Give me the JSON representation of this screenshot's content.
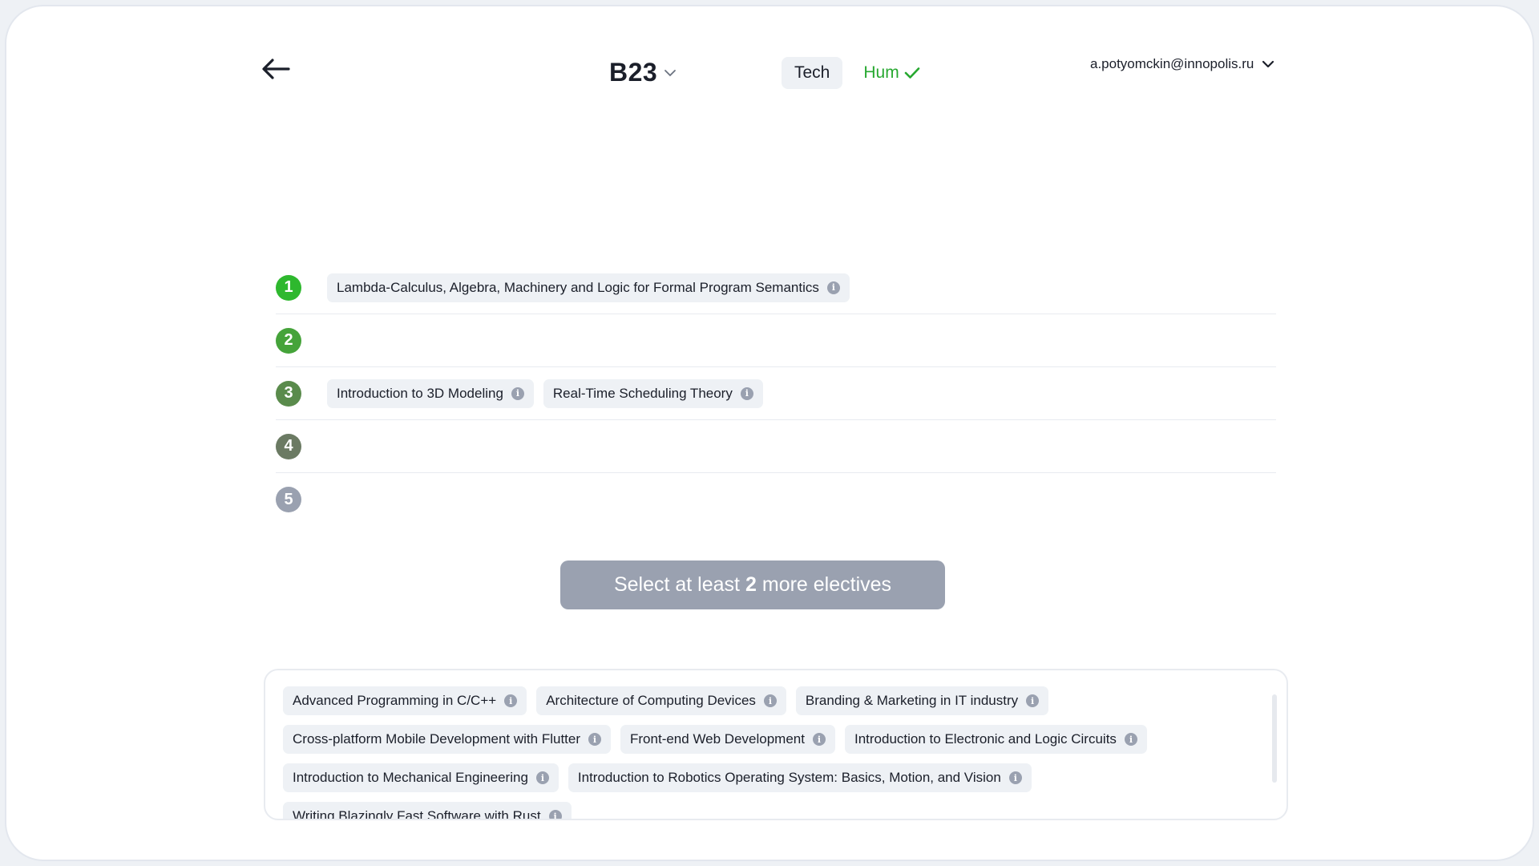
{
  "header": {
    "group": "B23",
    "tabs": [
      {
        "label": "Tech",
        "selected": true
      },
      {
        "label": "Hum",
        "completed": true
      }
    ],
    "user_email": "a.potyomckin@innopolis.ru"
  },
  "priorities": [
    {
      "number": "1",
      "color": "#2eb82e",
      "courses": [
        "Lambda-Calculus, Algebra, Machinery and Logic for Formal Program Semantics"
      ]
    },
    {
      "number": "2",
      "color": "#45a33a",
      "courses": []
    },
    {
      "number": "3",
      "color": "#5a8b4c",
      "courses": [
        "Introduction to 3D Modeling",
        "Real-Time Scheduling Theory"
      ]
    },
    {
      "number": "4",
      "color": "#6b7a63",
      "courses": []
    },
    {
      "number": "5",
      "color": "#9aa1b0",
      "courses": []
    }
  ],
  "submit": {
    "prefix": "Select at least",
    "count": "2",
    "suffix": "more electives"
  },
  "pool": {
    "courses": [
      "Advanced Programming in C/C++",
      "Architecture of Computing Devices",
      "Branding & Marketing in IT industry",
      "Cross-platform Mobile Development with Flutter",
      "Front-end Web Development",
      "Introduction to Electronic and Logic Circuits",
      "Introduction to Mechanical Engineering",
      "Introduction to Robotics Operating System: Basics, Motion, and Vision",
      "Writing Blazingly Fast Software with Rust"
    ]
  },
  "icons": {
    "back": "arrow-left-icon",
    "chevron": "chevron-down-icon",
    "check": "check-icon",
    "info": "info-icon"
  },
  "colors": {
    "accent_green": "#27a830",
    "chip_bg": "#eef1f5",
    "disabled_button": "#9aa1b0"
  }
}
